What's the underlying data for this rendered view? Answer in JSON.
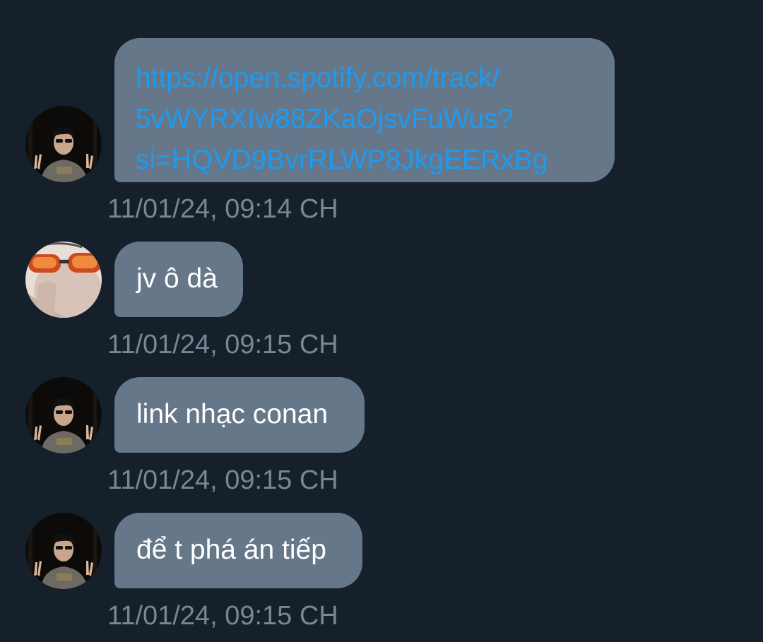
{
  "messages": [
    {
      "sender": "avatar-a",
      "link_lines": [
        "https://open.spotify.com/track/",
        "5vWYRXIw88ZKaOjsvFuWus?",
        "si=HQVD9BvrRLWP8JkgEERxBg"
      ],
      "timestamp": "11/01/24, 09:14 CH"
    },
    {
      "sender": "avatar-b",
      "text": "jv ô dà",
      "timestamp": "11/01/24, 09:15 CH"
    },
    {
      "sender": "avatar-a",
      "text": "link nhạc conan",
      "timestamp": "11/01/24, 09:15 CH"
    },
    {
      "sender": "avatar-a",
      "text": "để t phá án tiếp",
      "timestamp": "11/01/24, 09:15 CH"
    }
  ],
  "colors": {
    "background": "#15202b",
    "bubble": "#66778a",
    "link": "#1d9bf0",
    "timestamp": "#7a8694"
  }
}
